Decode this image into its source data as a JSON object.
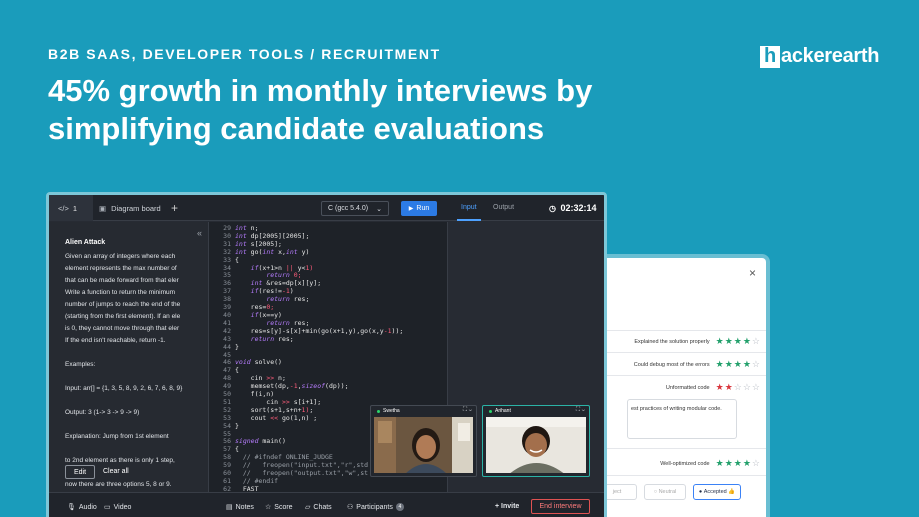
{
  "eyebrow": "B2B SAAS, DEVELOPER TOOLS / RECRUITMENT",
  "headline": "45% growth in monthly interviews by simplifying candidate evaluations",
  "logo": {
    "mark": "h",
    "text": "ackerearth"
  },
  "evaluation": {
    "close": "×",
    "ratings": [
      {
        "label": "Explained the solution properly",
        "stars": 4,
        "color": "#22a06b"
      },
      {
        "label": "Could debug most of the errors",
        "stars": 4,
        "color": "#22a06b"
      },
      {
        "label": "Unformatted code",
        "stars": 2,
        "color": "#d9363e"
      }
    ],
    "note": "est practices of writing modular code.",
    "rating_bottom": {
      "label": "Well-optimized code",
      "stars": 4,
      "color": "#22a06b"
    },
    "buttons": {
      "reject": "ject",
      "neutral": "Neutral",
      "accepted": "Accepted"
    }
  },
  "editor": {
    "tab1_label": "1",
    "tab2_label": "Diagram board",
    "language": "C (gcc 5.4.0)",
    "run_label": "Run",
    "input_tab": "Input",
    "output_tab": "Output",
    "timer": "02:32:14",
    "problem": {
      "title": "Alien Attack",
      "body": "Given an array of integers where each\nelement represents the max number of\nthat can be made forward from that eler\nWrite a function to return the minimum\nnumber of jumps to reach the end of the\n(starting from the first element). If an ele\nis 0, they cannot move through that eler\nIf the end isn't reachable, return -1.\n\nExamples:\n\nInput: arr[] = {1, 3, 5, 8, 9, 2, 6, 7, 6, 8, 9}\n\nOutput: 3 (1-> 3 -> 9 -> 9)\n\nExplanation: Jump from 1st element\n\nto 2nd element as there is only 1 step,\n\nnow there are three options 5, 8 or 9.",
      "edit_label": "Edit",
      "clear_label": "Clear all"
    },
    "line_start": 29,
    "code_lines": [
      "int n;",
      "int dp[2005][2005];",
      "int s[2005];",
      "int go(int x,int y)",
      "{",
      "    if(x+1>n || y<1)",
      "        return 0;",
      "    int &res=dp[x][y];",
      "    if(res!=-1)",
      "        return res;",
      "    res=0;",
      "    if(x==y)",
      "        return res;",
      "    res=s[y]-s[x]+min(go(x+1,y),go(x,y-1));",
      "    return res;",
      "}",
      "",
      "void solve()",
      "{",
      "    cin >> n;",
      "    memset(dp,-1,sizeof(dp));",
      "    f(i,n)",
      "        cin >> s[i+1];",
      "    sort(s+1,s+n+1);",
      "    cout << go(1,n) ;",
      "}",
      "",
      "signed main()",
      "{",
      "  // #ifndef ONLINE_JUDGE",
      "  //   freopen(\"input.txt\",\"r\",std",
      "  //   freopen(\"output.txt\",\"w\",st",
      "  // #endif",
      "  FAST",
      "  int T=1;"
    ],
    "participants_video": [
      {
        "name": "Swetha"
      },
      {
        "name": "Arihant"
      }
    ],
    "bottom": {
      "audio": "Audio",
      "video": "Video",
      "notes": "Notes",
      "score": "Score",
      "chats": "Chats",
      "participants": "Participants",
      "participants_count": "4",
      "invite": "+ Invite",
      "end": "End interview"
    }
  }
}
